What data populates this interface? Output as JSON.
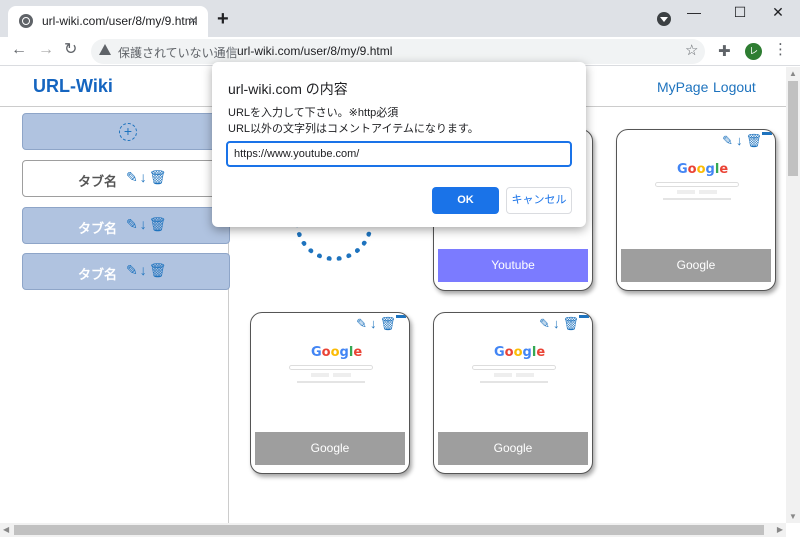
{
  "browser": {
    "tab_title": "url-wiki.com/user/8/my/9.html",
    "tab_close": "×",
    "new_tab": "+",
    "window_controls": [
      "—",
      "☐",
      "✕"
    ],
    "nav": {
      "back": "←",
      "forward": "→",
      "reload": "↻"
    },
    "security_warning": "保護されていない通信",
    "separator": "|",
    "url": "url-wiki.com/user/8/my/9.html",
    "star": "☆",
    "extensions": "✚",
    "profile_initial": "レ",
    "menu": "⋮"
  },
  "site": {
    "logo": "URL-Wiki",
    "links": [
      "MyPage",
      "Logout"
    ]
  },
  "sidebar": {
    "add_symbol": "+",
    "tabs": [
      {
        "name": "タブ名",
        "icons": "✎↓🗑"
      },
      {
        "name": "タブ名",
        "icons": "✎↓🗑"
      },
      {
        "name": "タブ名",
        "icons": "✎↓🗑"
      }
    ]
  },
  "cards": [
    {
      "label": "Youtube",
      "label_color": "#7b7bff",
      "icons": "✎↓🗑",
      "preview": ""
    },
    {
      "label": "Google",
      "label_color": "#9e9e9e",
      "icons": "✎↓🗑",
      "preview": "Google"
    },
    {
      "label": "Google",
      "label_color": "#9e9e9e",
      "icons": "✎↓🗑",
      "preview": "Google"
    },
    {
      "label": "Google",
      "label_color": "#9e9e9e",
      "icons": "✎↓🗑",
      "preview": "Google"
    }
  ],
  "dialog": {
    "title": "url-wiki.com の内容",
    "message_line1": "URLを入力して下さい。※http必須",
    "message_line2": "URL以外の文字列はコメントアイテムになります。",
    "input_value": "https://www.youtube.com/",
    "ok_label": "OK",
    "cancel_label": "キャンセル"
  }
}
